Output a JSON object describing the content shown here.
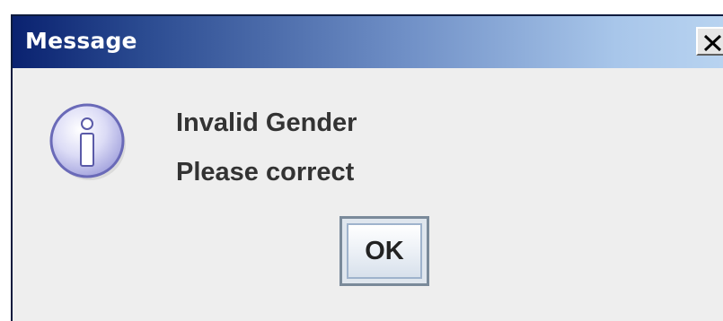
{
  "dialog": {
    "title": "Message",
    "close_label": "X",
    "icon": "info-icon",
    "message_lines": [
      "Invalid Gender",
      "Please correct"
    ],
    "ok_label": "OK"
  },
  "colors": {
    "title_dark": "#0a2270",
    "title_light": "#b8d3f0",
    "dialog_bg": "#eeeeee",
    "text": "#333333"
  }
}
